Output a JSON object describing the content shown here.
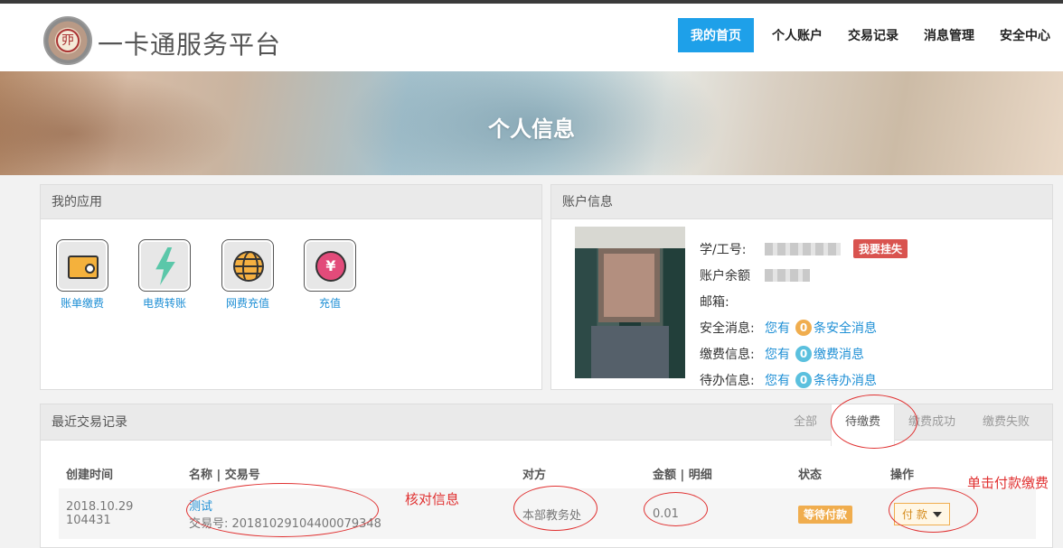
{
  "header": {
    "logo_char": "丣",
    "logo_text": "一卡通服务平台",
    "nav": [
      "我的首页",
      "个人账户",
      "交易记录",
      "消息管理",
      "安全中心"
    ]
  },
  "banner": {
    "title": "个人信息"
  },
  "apps": {
    "title": "我的应用",
    "items": [
      "账单缴费",
      "电费转账",
      "网费充值",
      "充值"
    ],
    "yen_symbol": "¥"
  },
  "account": {
    "title": "账户信息",
    "labels": {
      "id": "学/工号:",
      "balance": "账户余额",
      "email": "邮箱:",
      "security": "安全消息:",
      "payment": "缴费信息:",
      "todo": "待办信息:"
    },
    "report_loss": "我要挂失",
    "you_have": "您有",
    "security_count": "0",
    "security_suffix": "条安全消息",
    "payment_count": "0",
    "payment_suffix": "缴费消息",
    "todo_count": "0",
    "todo_suffix": "条待办消息",
    "colors": {
      "security": "#f0ad4e",
      "payment": "#5bc0de",
      "todo": "#5bc0de"
    }
  },
  "records": {
    "title": "最近交易记录",
    "filters": [
      "全部",
      "待缴费",
      "缴费成功",
      "缴费失败"
    ],
    "columns": [
      "创建时间",
      "名称 | 交易号",
      "对方",
      "金额 | 明细",
      "状态",
      "操作"
    ],
    "row": {
      "date": "2018.10.29",
      "time": "104431",
      "name": "测试",
      "txn": "交易号: 20181029104400079348",
      "party": "本部教务处",
      "amount": "0.01",
      "status": "等待付款",
      "action": "付 款"
    }
  },
  "annotations": {
    "verify": "核对信息",
    "click_pay": "单击付款缴费"
  }
}
